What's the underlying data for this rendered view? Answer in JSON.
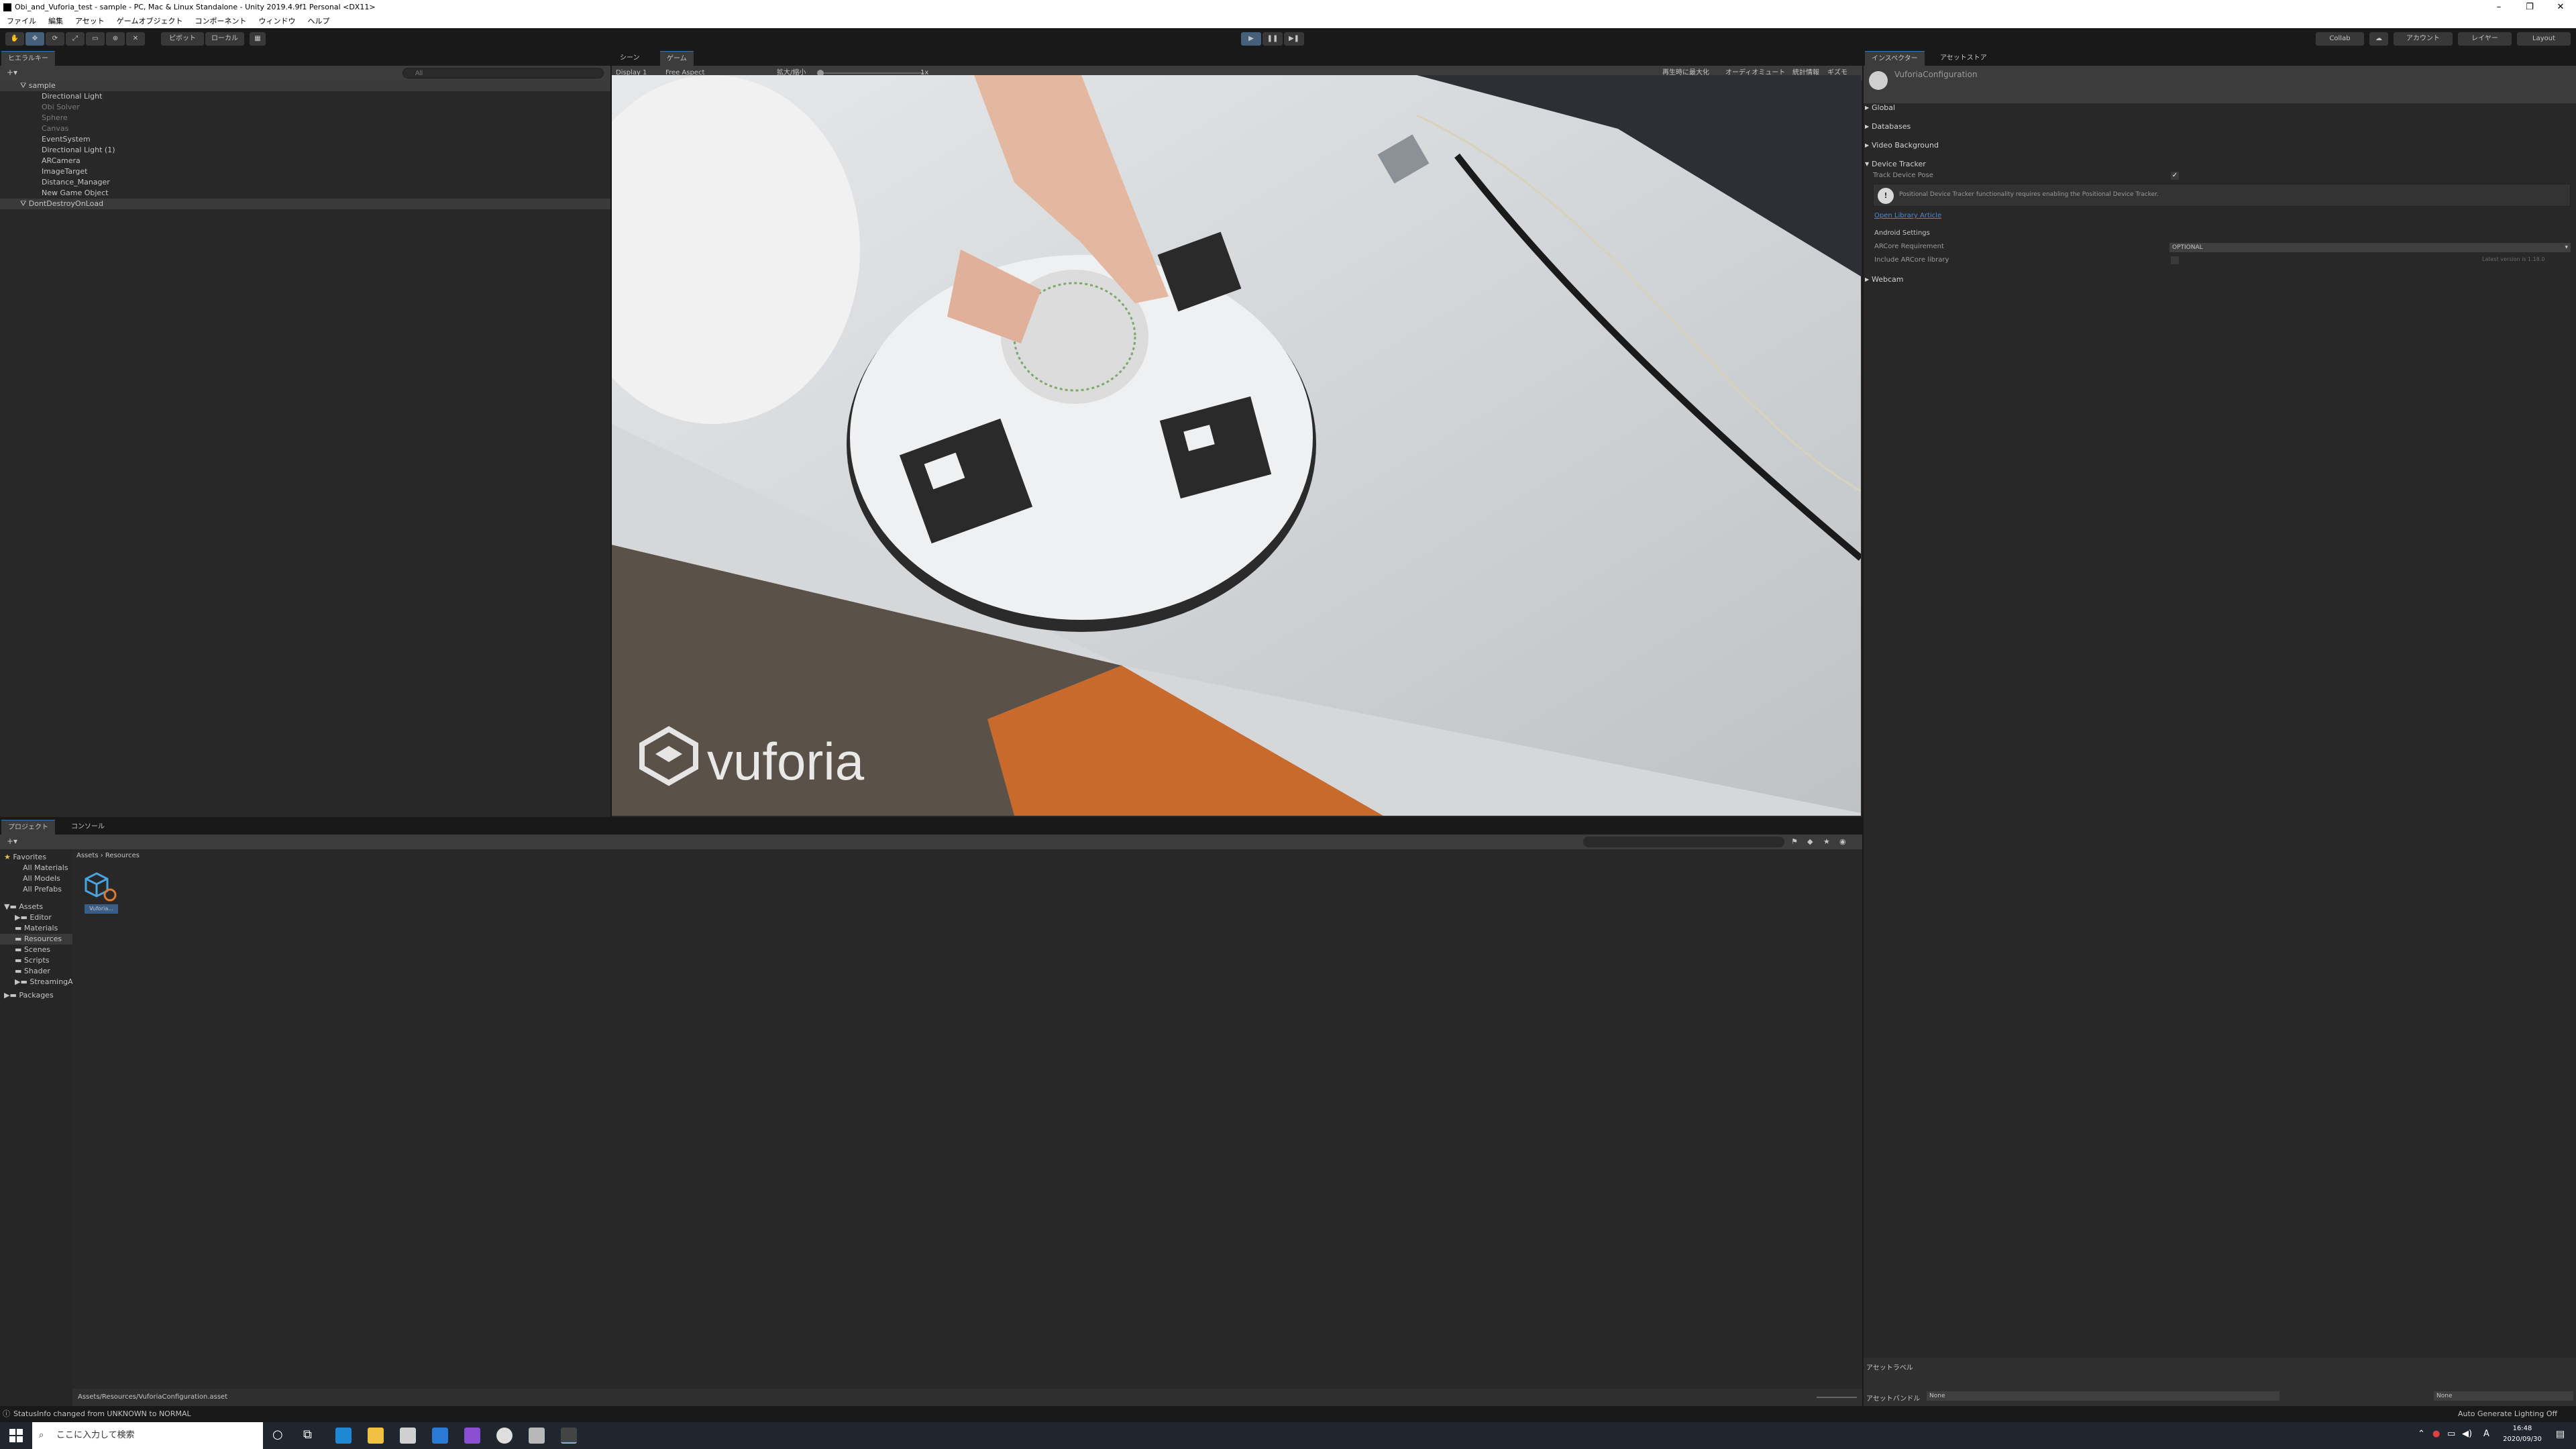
{
  "window": {
    "title": "Obi_and_Vuforia_test - sample - PC, Mac & Linux Standalone - Unity 2019.4.9f1 Personal <DX11>",
    "controls": [
      "–",
      "❐",
      "✕"
    ]
  },
  "menubar": [
    "ファイル",
    "編集",
    "アセット",
    "ゲームオブジェクト",
    "コンポーネント",
    "ウィンドウ",
    "ヘルプ"
  ],
  "toolbar": {
    "pivot_label": "ピボット",
    "local_label": "ローカル",
    "collab_label": "Collab",
    "account_label": "アカウント",
    "layers_label": "レイヤー",
    "layout_label": "Layout"
  },
  "hierarchy": {
    "tab_label": "ヒエラルキー",
    "search_placeholder": "All",
    "scene_name": "sample",
    "items": [
      {
        "label": "Directional Light",
        "dim": false
      },
      {
        "label": "Obi Solver",
        "dim": true
      },
      {
        "label": "Sphere",
        "dim": true
      },
      {
        "label": "Canvas",
        "dim": true
      },
      {
        "label": "EventSystem",
        "dim": false
      },
      {
        "label": "Directional Light (1)",
        "dim": false
      },
      {
        "label": "ARCamera",
        "dim": false
      },
      {
        "label": "ImageTarget",
        "dim": false
      },
      {
        "label": "Distance_Manager",
        "dim": false
      },
      {
        "label": "New Game Object",
        "dim": false
      }
    ],
    "dontdestroy_label": "DontDestroyOnLoad"
  },
  "view_tabs": {
    "scene_label": "シーン",
    "game_label": "ゲーム"
  },
  "game_toolbar": {
    "display": "Display 1",
    "aspect": "Free Aspect",
    "scale_label": "拡大/縮小",
    "scale_value": "1x",
    "maximize_on_play": "再生時に最大化",
    "mute_audio": "オーディオミュート",
    "stats": "統計情報",
    "gizmos": "ギズモ"
  },
  "game_view": {
    "watermark": "vuforia"
  },
  "inspector": {
    "tab_label": "インスペクター",
    "asset_store_label": "アセットストア",
    "asset_name": "VuforiaConfiguration",
    "sections": {
      "global": "Global",
      "databases": "Databases",
      "video_background": "Video Background",
      "device_tracker": "Device Tracker",
      "webcam": "Webcam"
    },
    "track_device_pose_label": "Track Device Pose",
    "warning_text": "Positional Device Tracker functionality requires enabling the Positional Device Tracker.",
    "library_link": "Open Library Article",
    "android_settings_label": "Android Settings",
    "arcore_requirement_label": "ARCore Requirement",
    "arcore_requirement_value": "OPTIONAL",
    "include_arcore_label": "Include ARCore library",
    "arcore_version_note": "Latest version is 1.18.0",
    "asset_labels": "アセットラベル",
    "asset_bundle_label": "アセットバンドル",
    "asset_bundle_value": "None",
    "asset_bundle_variant": "None"
  },
  "project": {
    "tab_label": "プロジェクト",
    "console_label": "コンソール",
    "favorites_label": "Favorites",
    "favorites": [
      "All Materials",
      "All Models",
      "All Prefabs"
    ],
    "assets_label": "Assets",
    "folders": [
      "Editor",
      "Materials",
      "Resources",
      "Scenes",
      "Scripts",
      "Shader",
      "StreamingAssets"
    ],
    "packages_label": "Packages",
    "breadcrumb": [
      "Assets",
      "Resources"
    ],
    "asset_item_label": "Vuforia...",
    "selected_path": "Assets/Resources/VuforiaConfiguration.asset"
  },
  "statusbar": {
    "message": "StatusInfo changed from UNKNOWN to NORMAL",
    "right": "Auto Generate Lighting Off"
  },
  "taskbar": {
    "search_placeholder": "ここに入力して検索",
    "time": "16:48",
    "date": "2020/09/30",
    "ime": "A"
  },
  "colors": {
    "accent": "#3a72b0",
    "panel": "#282828",
    "panel_dark": "#191919",
    "link": "#4c8ad8"
  }
}
